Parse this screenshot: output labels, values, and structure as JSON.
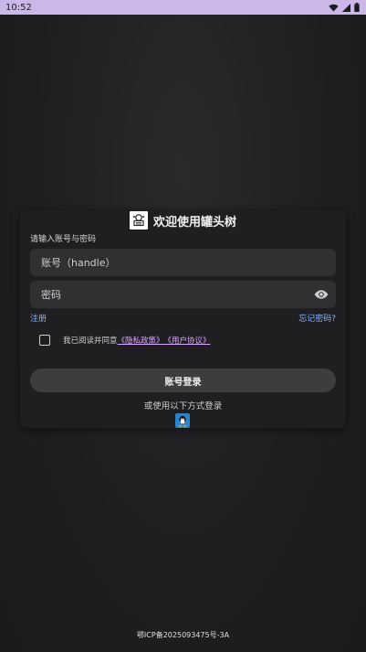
{
  "status_bar": {
    "time": "10:52",
    "icons": [
      "wifi-icon",
      "signal-icon",
      "battery-icon"
    ]
  },
  "header": {
    "app_title": "欢迎使用罐头树",
    "logo_icon": "app-logo-icon"
  },
  "login_form": {
    "hint": "请输入账号与密码",
    "username_placeholder": "账号（handle）",
    "password_placeholder": "密码",
    "password_toggle_icon": "eye-icon",
    "register_link": "注册",
    "forgot_link": "忘记密码?",
    "agree_prefix": "我已阅读并同意",
    "privacy_link": "《隐私政策》",
    "terms_link": "《用户协议》",
    "login_button": "账号登录",
    "other_methods": "或使用以下方式登录",
    "qq_icon": "qq-icon"
  },
  "footer": {
    "icp": "鄂ICP备2025093475号-3A"
  },
  "colors": {
    "status_bar_bg": "#cbb7e8",
    "background": "#1d1d1f",
    "card_bg": "#1f1f21",
    "field_bg": "#303033",
    "link_blue": "#8ab4f8",
    "link_purple": "#d8a8ff",
    "button_bg": "#3d3d40"
  }
}
